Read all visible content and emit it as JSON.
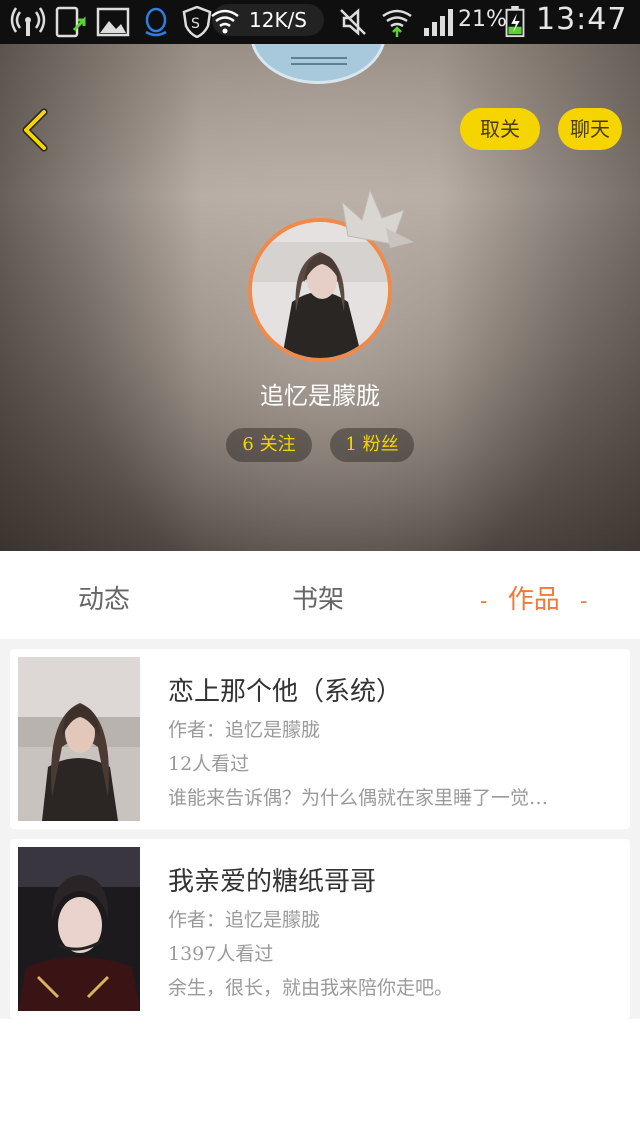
{
  "status_bar": {
    "speed": "12K/S",
    "battery_percent": "21%",
    "time": "13:47",
    "icons": [
      "wireless-icon",
      "usb-icon",
      "image-icon",
      "qq-icon",
      "security-icon",
      "wifi-icon",
      "mute-icon",
      "signal-wifi-icon",
      "signal-bars-icon",
      "battery-charging-icon"
    ]
  },
  "header": {
    "unfollow_label": "取关",
    "chat_label": "聊天",
    "nickname": "追忆是朦胧",
    "following": "6 关注",
    "followers": "1 粉丝",
    "colors": {
      "accent_yellow": "#f6d400",
      "avatar_border": "#f08a4b"
    }
  },
  "tabs": [
    {
      "label": "动态",
      "active": false
    },
    {
      "label": "书架",
      "active": false
    },
    {
      "label": "作品",
      "active": true,
      "decor": "-"
    }
  ],
  "works": [
    {
      "title": "恋上那个他（系统）",
      "author": "作者：追忆是朦胧",
      "views": "12人看过",
      "desc": "谁能来告诉偶？为什么偶就在家里睡了一觉…"
    },
    {
      "title": "我亲爱的糖纸哥哥",
      "author": "作者：追忆是朦胧",
      "views": "1397人看过",
      "desc": "余生，很长，就由我来陪你走吧。"
    }
  ]
}
